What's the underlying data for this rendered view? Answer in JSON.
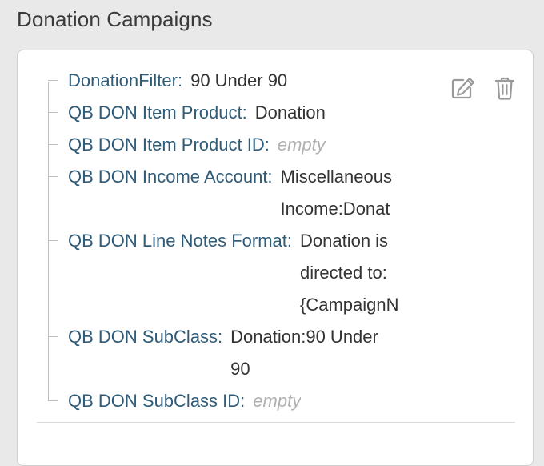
{
  "section": {
    "title": "Donation Campaigns"
  },
  "campaign": {
    "properties": [
      {
        "label": "DonationFilter:",
        "value": "90 Under 90",
        "empty": false
      },
      {
        "label": "QB DON Item Product:",
        "value": "Donation",
        "empty": false
      },
      {
        "label": "QB DON Item Product ID:",
        "value": "empty",
        "empty": true
      },
      {
        "label": "QB DON Income Account:",
        "value": "Miscellaneous\nIncome:Donat",
        "empty": false
      },
      {
        "label": "QB DON Line Notes Format:",
        "value": "Donation is\ndirected to:\n{CampaignN",
        "empty": false
      },
      {
        "label": "QB DON SubClass:",
        "value": "Donation:90 Under\n90",
        "empty": false
      },
      {
        "label": "QB DON SubClass ID:",
        "value": "empty",
        "empty": true
      }
    ],
    "actions": {
      "edit_icon": "edit-icon",
      "delete_icon": "trash-icon"
    }
  },
  "colors": {
    "label": "#2f5c78",
    "value": "#333333",
    "empty": "#b0b0b0",
    "icon": "#9a9a9a"
  }
}
